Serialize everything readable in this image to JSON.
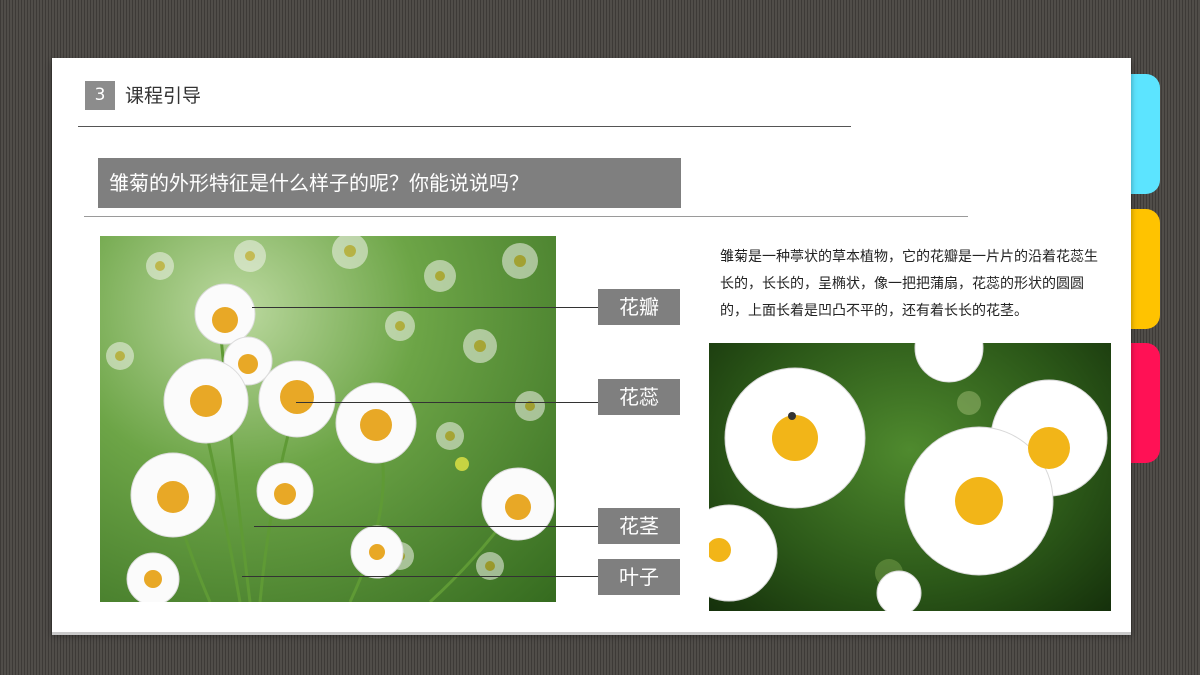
{
  "section": {
    "number": "3",
    "title": "课程引导"
  },
  "question": "雏菊的外形特征是什么样子的呢？你能说说吗？",
  "labels": {
    "petal": "花瓣",
    "stamen": "花蕊",
    "stem": "花茎",
    "leaf": "叶子"
  },
  "description": "雏菊是一种葶状的草本植物，它的花瓣是一片片的沿着花蕊生长的，长长的，呈椭状，像一把把蒲扇，花蕊的形状的圆圆的，上面长着是凹凸不平的，还有着长长的花茎。",
  "colors": {
    "tab_cyan": "#5ce4ff",
    "tab_yellow": "#ffc300",
    "tab_red": "#ff1155",
    "label_gray": "#7f7f7f"
  }
}
